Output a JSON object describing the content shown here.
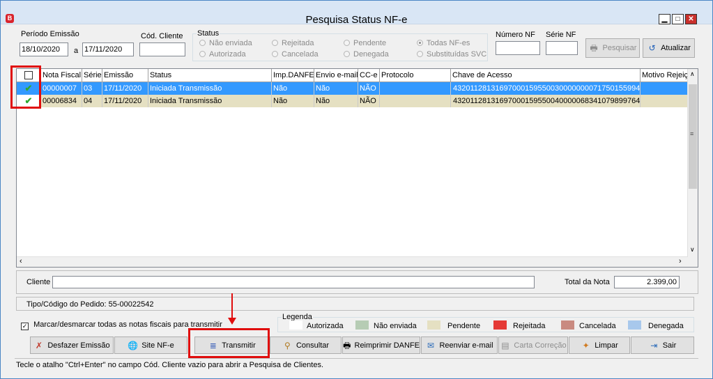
{
  "window": {
    "title": "Pesquisa Status NF-e",
    "app_icon": "B",
    "minimize": "▁",
    "maximize": "□",
    "close": "✕"
  },
  "filters": {
    "periodo_label": "Período Emissão",
    "date_from": "18/10/2020",
    "date_sep": "a",
    "date_to": "17/11/2020",
    "cod_cliente_label": "Cód. Cliente",
    "cod_cliente_value": "",
    "status_label": "Status",
    "status_options": [
      "Não enviada",
      "Rejeitada",
      "Pendente",
      "Todas NF-es",
      "Autorizada",
      "Cancelada",
      "Denegada",
      "Substituídas SVC"
    ],
    "status_selected": "Todas NF-es",
    "numero_nf_label": "Número NF",
    "numero_nf_value": "",
    "serie_nf_label": "Série NF",
    "serie_nf_value": "",
    "pesquisar_label": "Pesquisar",
    "atualizar_label": "Atualizar"
  },
  "grid": {
    "columns": [
      "",
      "Nota Fiscal",
      "Série",
      "Emissão",
      "Status",
      "Imp.DANFE",
      "Envio e-mail",
      "CC-e",
      "Protocolo",
      "Chave de Acesso",
      "Motivo Rejeição"
    ],
    "rows": [
      {
        "checked": true,
        "nota": "00000007",
        "serie": "03",
        "emissao": "17/11/2020",
        "status": "Iniciada Transmissão",
        "imp": "Não",
        "envio": "Não",
        "cce": "NÃO",
        "protocolo": "",
        "chave": "43201128131697000159550030000000071750155994",
        "motivo": ""
      },
      {
        "checked": true,
        "nota": "00006834",
        "serie": "04",
        "emissao": "17/11/2020",
        "status": "Iniciada Transmissão",
        "imp": "Não",
        "envio": "Não",
        "cce": "NÃO",
        "protocolo": "",
        "chave": "43201128131697000159550040000068341079899764",
        "motivo": ""
      }
    ]
  },
  "details": {
    "cliente_label": "Cliente",
    "cliente_value": "",
    "total_label": "Total da Nota",
    "total_value": "2.399,00",
    "pedido_text": "Tipo/Código do Pedido: 55-00022542",
    "marcar_label": "Marcar/desmarcar todas as notas fiscais para transmitir"
  },
  "legend": {
    "title": "Legenda",
    "items": [
      {
        "label": "Autorizada",
        "color": "#ffffff"
      },
      {
        "label": "Não enviada",
        "color": "#b6ccb4"
      },
      {
        "label": "Pendente",
        "color": "#e5e0c2"
      },
      {
        "label": "Rejeitada",
        "color": "#e53935"
      },
      {
        "label": "Cancelada",
        "color": "#c98a80"
      },
      {
        "label": "Denegada",
        "color": "#a8c8ec"
      }
    ]
  },
  "buttons": {
    "desfazer": "Desfazer Emissão",
    "site": "Site NF-e",
    "transmitir": "Transmitir",
    "consultar": "Consultar",
    "reimprimir": "Reimprimir DANFE",
    "reenviar": "Reenviar e-mail",
    "carta": "Carta Correção",
    "limpar": "Limpar",
    "sair": "Sair"
  },
  "status_bar": "Tecle o atalho \"Ctrl+Enter\" no campo Cód. Cliente vazio para abrir a Pesquisa de Clientes.",
  "colors": {
    "selected_row": "#3399ff",
    "pending_row": "#e5e0c2",
    "highlight": "#e00d0d"
  }
}
